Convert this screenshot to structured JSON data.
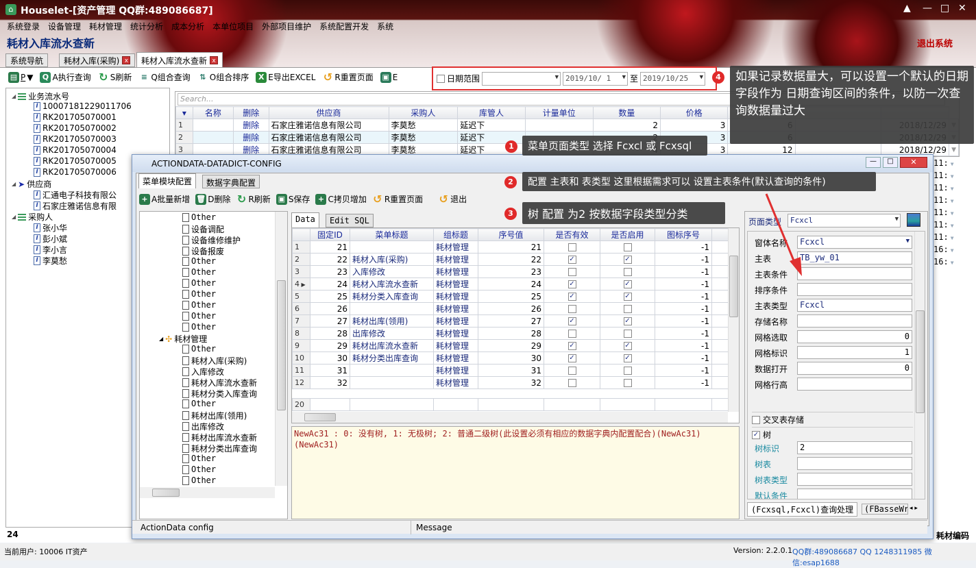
{
  "window": {
    "title": "Houselet-[资产管理 QQ群:489086687]",
    "app_icon": "house-icon"
  },
  "menu": [
    "系统登录",
    "设备管理",
    "耗材管理",
    "统计分析",
    "成本分析",
    "本单位项目",
    "外部项目维护",
    "系统配置开发",
    "系统"
  ],
  "page_title": "耗材入库流水查新",
  "logout": "退出系统",
  "tabs": [
    {
      "label": "系统导航",
      "closable": false
    },
    {
      "label": "耗材入库(采购)",
      "closable": true
    },
    {
      "label": "耗材入库流水查新",
      "closable": true,
      "active": true
    }
  ],
  "toolbar": {
    "print": "P",
    "exec": "A执行查询",
    "refresh": "S刷新",
    "combo_query": "Q组合查询",
    "combo_sort": "O组合排序",
    "export": "E导出EXCEL",
    "reset": "R重置页面",
    "e2": "E"
  },
  "date_filter": {
    "label": "日期范围",
    "checked": false,
    "field": "",
    "from": "2019/10/ 1",
    "to_label": "至",
    "to": "2019/10/25"
  },
  "annotations": [
    {
      "n": "1",
      "text": "菜单页面类型 选择 Fcxcl 或 Fcxsql"
    },
    {
      "n": "2",
      "text": "配置 主表和 表类型 这里根据需求可以 设置主表条件(默认查询的条件)"
    },
    {
      "n": "3",
      "text": "树 配置 为2 按数据字段类型分类"
    },
    {
      "n": "4",
      "text": "如果记录数据量大，可以设置一个默认的日期字段作为 日期查询区间的条件，以防一次查询数据量过大"
    }
  ],
  "left_tree": [
    {
      "label": "业务流水号",
      "level": 0,
      "kind": "group"
    },
    {
      "label": "10007181229011706",
      "level": 1
    },
    {
      "label": "RK201705070001",
      "level": 1
    },
    {
      "label": "RK201705070002",
      "level": 1
    },
    {
      "label": "RK201705070003",
      "level": 1
    },
    {
      "label": "RK201705070004",
      "level": 1
    },
    {
      "label": "RK201705070005",
      "level": 1
    },
    {
      "label": "RK201705070006",
      "level": 1
    },
    {
      "label": "供应商",
      "level": 0,
      "kind": "arrow"
    },
    {
      "label": "汇通电子科技有限公",
      "level": 1
    },
    {
      "label": "石家庄雅诺信息有限",
      "level": 1
    },
    {
      "label": "采购人",
      "level": 0,
      "kind": "group"
    },
    {
      "label": "张小华",
      "level": 1
    },
    {
      "label": "彭小斌",
      "level": 1
    },
    {
      "label": "李小言",
      "level": 1
    },
    {
      "label": "李莫愁",
      "level": 1
    }
  ],
  "left_count": "24",
  "main_grid": {
    "search_placeholder": "Search...",
    "columns": [
      "名称",
      "删除",
      "供应商",
      "采购人",
      "库管人",
      "计量单位",
      "数量",
      "价格"
    ],
    "rows": [
      {
        "n": "1",
        "name": "",
        "del": "删除",
        "supplier": "石家庄雅诺信息有限公司",
        "buyer": "李莫愁",
        "keeper": "延迟下",
        "unit": "",
        "qty": "2",
        "price": "3",
        "amount": "6",
        "date": "2018/12/29"
      },
      {
        "n": "2",
        "name": "",
        "del": "删除",
        "supplier": "石家庄雅诺信息有限公司",
        "buyer": "李莫愁",
        "keeper": "延迟下",
        "unit": "",
        "qty": "2",
        "price": "3",
        "amount": "6",
        "date": "2018/12/29"
      },
      {
        "n": "3",
        "name": "",
        "del": "删除",
        "supplier": "石家庄雅诺信息有限公司",
        "buyer": "李莫愁",
        "keeper": "延迟下",
        "unit": "",
        "qty": "4",
        "price": "3",
        "amount": "12",
        "date": "2018/12/29"
      }
    ],
    "time_col": [
      "11:",
      "11:",
      "11:",
      "11:",
      "11:",
      "11:",
      "11:",
      "16:",
      "16:"
    ],
    "right_label": "耗材编码"
  },
  "dialog": {
    "title": "ACTIONDATA-DATADICT-CONFIG",
    "tabs": [
      "菜单模块配置",
      "数据字典配置"
    ],
    "toolbar": [
      "A批量新增",
      "D删除",
      "R刷新",
      "S保存",
      "C拷贝增加",
      "R重置页面",
      "退出"
    ],
    "tree": [
      {
        "label": "Other"
      },
      {
        "label": "设备调配"
      },
      {
        "label": "设备维修维护"
      },
      {
        "label": "设备报废"
      },
      {
        "label": "Other"
      },
      {
        "label": "Other"
      },
      {
        "label": "Other"
      },
      {
        "label": "Other"
      },
      {
        "label": "Other"
      },
      {
        "label": "Other"
      },
      {
        "label": "Other"
      },
      {
        "label": "耗材管理",
        "parent": true
      },
      {
        "label": "Other"
      },
      {
        "label": "耗材入库(采购)"
      },
      {
        "label": "入库修改"
      },
      {
        "label": "耗材入库流水查新"
      },
      {
        "label": "耗材分类入库查询"
      },
      {
        "label": "Other"
      },
      {
        "label": "耗材出库(领用)"
      },
      {
        "label": "出库修改"
      },
      {
        "label": "耗材出库流水查新"
      },
      {
        "label": "耗材分类出库查询"
      },
      {
        "label": "Other"
      },
      {
        "label": "Other"
      },
      {
        "label": "Other"
      }
    ],
    "data_tabs": [
      "Data",
      "Edit SQL"
    ],
    "grid": {
      "columns": [
        "固定ID",
        "菜单标题",
        "组标题",
        "序号值",
        "是否有效",
        "是否启用",
        "图标序号"
      ],
      "rows": [
        {
          "n": "1",
          "id": "21",
          "title": "",
          "group": "耗材管理",
          "seq": "21",
          "valid": false,
          "enabled": false,
          "icon": "-1"
        },
        {
          "n": "2",
          "id": "22",
          "title": "耗材入库(采购)",
          "group": "耗材管理",
          "seq": "22",
          "valid": true,
          "enabled": true,
          "icon": "-1"
        },
        {
          "n": "3",
          "id": "23",
          "title": "入库修改",
          "group": "耗材管理",
          "seq": "23",
          "valid": false,
          "enabled": false,
          "icon": "-1"
        },
        {
          "n": "4",
          "id": "24",
          "title": "耗材入库流水查新",
          "group": "耗材管理",
          "seq": "24",
          "valid": true,
          "enabled": true,
          "icon": "-1",
          "current": true
        },
        {
          "n": "5",
          "id": "25",
          "title": "耗材分类入库查询",
          "group": "耗材管理",
          "seq": "25",
          "valid": true,
          "enabled": true,
          "icon": "-1"
        },
        {
          "n": "6",
          "id": "26",
          "title": "",
          "group": "耗材管理",
          "seq": "26",
          "valid": false,
          "enabled": false,
          "icon": "-1"
        },
        {
          "n": "7",
          "id": "27",
          "title": "耗材出库(领用)",
          "group": "耗材管理",
          "seq": "27",
          "valid": true,
          "enabled": true,
          "icon": "-1"
        },
        {
          "n": "8",
          "id": "28",
          "title": "出库修改",
          "group": "耗材管理",
          "seq": "28",
          "valid": false,
          "enabled": false,
          "icon": "-1"
        },
        {
          "n": "9",
          "id": "29",
          "title": "耗材出库流水查新",
          "group": "耗材管理",
          "seq": "29",
          "valid": true,
          "enabled": true,
          "icon": "-1"
        },
        {
          "n": "10",
          "id": "30",
          "title": "耗材分类出库查询",
          "group": "耗材管理",
          "seq": "30",
          "valid": true,
          "enabled": true,
          "icon": "-1"
        },
        {
          "n": "11",
          "id": "31",
          "title": "",
          "group": "耗材管理",
          "seq": "31",
          "valid": false,
          "enabled": false,
          "icon": "-1"
        },
        {
          "n": "12",
          "id": "32",
          "title": "",
          "group": "耗材管理",
          "seq": "32",
          "valid": false,
          "enabled": false,
          "icon": "-1"
        }
      ],
      "footer_row": "20"
    },
    "message": "NewAc31 : 0: 没有树, 1: 无极树; 2: 普通二级树(此设置必须有相应的数据字典内配置配合)(NewAc31)(NewAc31)",
    "panel": {
      "page_type_label": "页面类型",
      "page_type": "Fcxcl",
      "fields": [
        {
          "label": "窗体名称",
          "value": "Fcxcl",
          "dropdown": true
        },
        {
          "label": "主表",
          "value": "TB_yw_01"
        },
        {
          "label": "主表条件",
          "value": ""
        },
        {
          "label": "排序条件",
          "value": ""
        },
        {
          "label": "主表类型",
          "value": "Fcxcl"
        },
        {
          "label": "存储名称",
          "value": ""
        },
        {
          "label": "网格选取",
          "value": "0",
          "num": true
        },
        {
          "label": "网格标识",
          "value": "1",
          "num": true
        },
        {
          "label": "数据打开",
          "value": "0",
          "num": true
        },
        {
          "label": "网格行高",
          "value": ""
        }
      ],
      "cross_table": {
        "label": "交叉表存储",
        "checked": false
      },
      "tree": {
        "label": "树",
        "checked": true
      },
      "tree_fields": [
        {
          "label": "树标识",
          "value": "2"
        },
        {
          "label": "树表",
          "value": ""
        },
        {
          "label": "树表类型",
          "value": ""
        },
        {
          "label": "默认条件",
          "value": ""
        }
      ],
      "bottom_tabs": [
        "(Fcxsql,Fcxcl)查询处理",
        "(FBasseWr"
      ]
    },
    "status": [
      "ActionData  config",
      "Message"
    ]
  },
  "statusbar": {
    "user": "当前用户:  10006 IT资产",
    "version": "Version: 2.2.0.1",
    "contact": "QQ群:489086687 QQ  1248311985 微信:esap1688"
  },
  "colors": {
    "accent": "#1a2a9a",
    "annotation_badge": "#e02a2a",
    "highlight_border": "#e03030",
    "arrow": "#e03030"
  }
}
